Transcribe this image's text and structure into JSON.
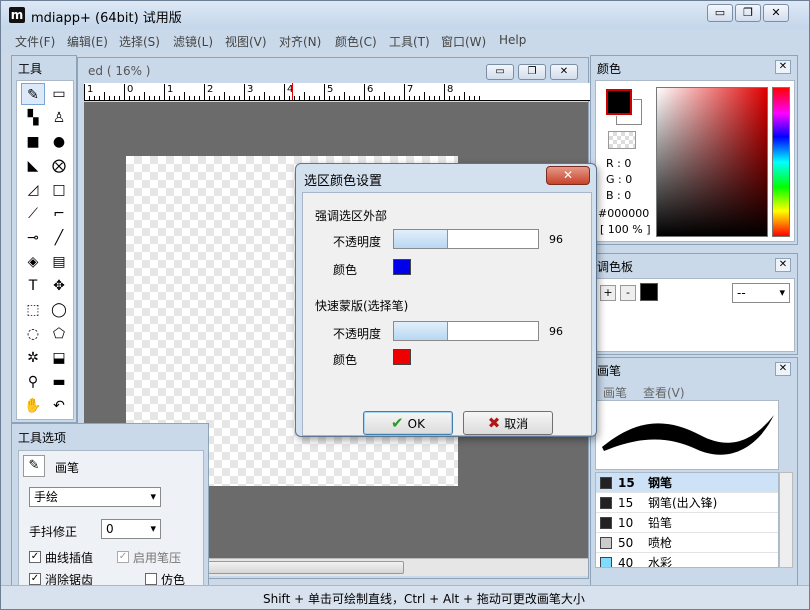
{
  "app": {
    "title": "mdiapp+ (64bit) 试用版",
    "logo_letter": "m",
    "minimize_glyph": "▭",
    "restore_glyph": "❐",
    "close_glyph": "✕"
  },
  "menu": [
    "文件(F)",
    "编辑(E)",
    "选择(S)",
    "滤镜(L)",
    "视图(V)",
    "对齐(N)",
    "颜色(C)",
    "工具(T)",
    "窗口(W)",
    "Help"
  ],
  "document": {
    "title_fragment": "ed",
    "zoom": "( 16% )",
    "ruler_labels": [
      "1",
      "0",
      "1",
      "2",
      "3",
      "4",
      "5",
      "6",
      "7",
      "8"
    ]
  },
  "tools_panel": {
    "title": "工具",
    "icons": [
      "pencil-icon",
      "eraser-icon",
      "dither-icon",
      "stamp-icon",
      "rect-fill-icon",
      "ellipse-fill-icon",
      "polygon-fill-icon",
      "fill-lasso-icon",
      "curve-shape-icon",
      "rectangle-icon",
      "line-tool-icon",
      "corner-icon",
      "pen-icon",
      "brush-icon",
      "bucket-icon",
      "gradient-icon",
      "text-icon",
      "move-icon",
      "rect-select-icon",
      "ellipse-select-icon",
      "lasso-select-icon",
      "polygon-select-icon",
      "magic-wand-icon",
      "transform-icon",
      "eyedropper-icon",
      "ruler-icon",
      "hand-icon",
      "rotate-hand-icon"
    ],
    "glyphs": [
      "✎",
      "▭",
      "▚",
      "♙",
      "■",
      "●",
      "◣",
      "⨂",
      "◿",
      "□",
      "⟋",
      "⌐",
      "⊸",
      "╱",
      "◈",
      "▤",
      "T",
      "✥",
      "⬚",
      "◯",
      "◌",
      "⬠",
      "✲",
      "⬓",
      "⚲",
      "▬",
      "✋",
      "↶"
    ]
  },
  "tool_options": {
    "title": "工具选项",
    "tool_name": "画笔",
    "mode": "手绘",
    "stabilizer_label": "手抖修正",
    "stabilizer_value": "0",
    "curve_interp": "曲线插值",
    "pressure": "启用笔压",
    "antialias": "消除锯齿",
    "emulate": "仿色",
    "check_glyph": "✓"
  },
  "color_panel": {
    "title": "颜色",
    "r": "R : 0",
    "g": "G : 0",
    "b": "B : 0",
    "hex": "#000000",
    "opacity": "[ 100 % ]",
    "fg_color": "#000000",
    "bg_color": "#ffffff"
  },
  "palette_panel": {
    "title": "调色板",
    "add": "+",
    "remove": "-",
    "select_value": "--"
  },
  "brush_panel": {
    "title": "画笔",
    "tab_brush": "画笔",
    "tab_view": "查看(V)",
    "rows": [
      {
        "size": "15",
        "name": "钢笔",
        "color": "#222222"
      },
      {
        "size": "15",
        "name": "钢笔(出入锋)",
        "color": "#222222"
      },
      {
        "size": "10",
        "name": "铅笔",
        "color": "#222222"
      },
      {
        "size": "50",
        "name": "喷枪",
        "color": "#cccccc"
      },
      {
        "size": "40",
        "name": "水彩",
        "color": "#7fdcff"
      }
    ]
  },
  "statusbar": {
    "text": "Shift + 单击可绘制直线，Ctrl + Alt + 拖动可更改画笔大小"
  },
  "dialog": {
    "title": "选区颜色设置",
    "close": "✕",
    "section1": "强调选区外部",
    "opacity_label": "不透明度",
    "color_label": "颜色",
    "section1_opacity": 96,
    "section1_opacity_text": "96",
    "section1_color": "#0000e8",
    "section2": "快速蒙版(选择笔)",
    "section2_opacity": 96,
    "section2_opacity_text": "96",
    "section2_color": "#ee0000",
    "ok": "OK",
    "cancel": "取消",
    "ok_glyph": "✔",
    "cancel_glyph": "✖"
  }
}
